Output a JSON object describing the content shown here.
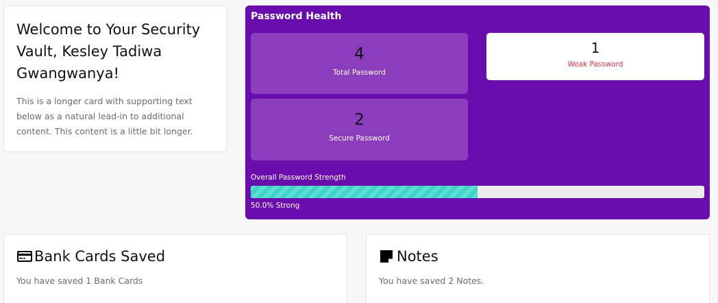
{
  "welcome": {
    "title": "Welcome to Your Security Vault, Kesley Tadiwa Gwangwanya!",
    "text": "This is a longer card with supporting text below as a natural lead-in to additional content. This content is a little bit longer."
  },
  "health": {
    "title": "Password Health",
    "total": {
      "value": "4",
      "label": "Total Password"
    },
    "weak": {
      "value": "1",
      "label": "Weak Password"
    },
    "secure": {
      "value": "2",
      "label": "Secure Password"
    },
    "strength": {
      "label": "Overall Password Strength",
      "percent": 50,
      "text": "50.0% Strong"
    }
  },
  "bank_cards": {
    "icon": "credit-card-icon",
    "title": "Bank Cards Saved",
    "text": "You have saved 1 Bank Cards"
  },
  "notes": {
    "icon": "sticky-note-icon",
    "title": "Notes",
    "text": "You have saved 2 Notes."
  },
  "colors": {
    "panel": "#6a0dad",
    "stat_tile": "#8a3ebd",
    "progress": "#3cd6c9",
    "weak_text": "#dc3545"
  }
}
